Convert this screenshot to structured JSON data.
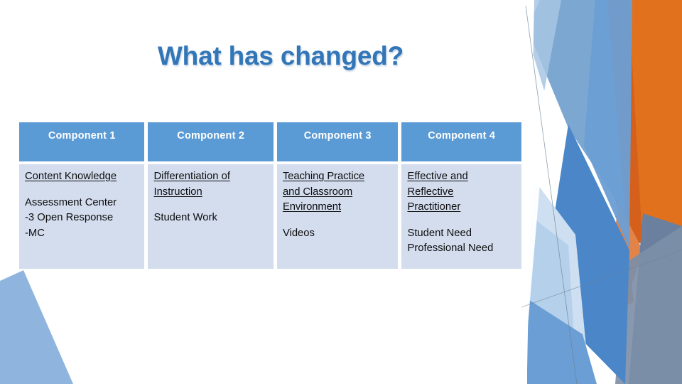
{
  "slide": {
    "title": "What has changed?",
    "title_color": "#3276b8",
    "background": "#ffffff"
  },
  "table": {
    "header_bg": "#5b9bd5",
    "header_text_color": "#ffffff",
    "cell_bg": "#d3ddee",
    "cell_text_color": "#0d0d0d",
    "headers": [
      "Component 1",
      "Component 2",
      "Component  3",
      "Component  4"
    ],
    "columns": [
      {
        "heading": "Content Knowledge",
        "lines": [
          "Assessment Center",
          "-3 Open Response",
          "-MC"
        ]
      },
      {
        "heading_line1": "Differentiation of",
        "heading_line2": "Instruction",
        "lines": [
          "Student Work"
        ]
      },
      {
        "heading_line1": "Teaching Practice",
        "heading_line2": "and Classroom",
        "heading_line3": "Environment",
        "lines": [
          "Videos"
        ]
      },
      {
        "heading_line1": "Effective and",
        "heading_line2": "Reflective",
        "heading_line3": "Practitioner",
        "lines": [
          "Student Need",
          "Professional Need"
        ]
      }
    ]
  },
  "decoration": {
    "name": "facet-theme-polygons",
    "colors": {
      "orange_dark": "#d4601c",
      "orange_mid": "#e2711d",
      "orange_light": "#e0844a",
      "blue_steel": "#7ba7d0",
      "blue_mid": "#6b9ed4",
      "blue_deep": "#4a86c8",
      "blue_pale": "#c3d8ee",
      "blue_paler": "#dfeaf6",
      "blue_gray": "#6b7f9e",
      "blue_gray_light": "#7d8fa8",
      "blue_left": "#8fb4dd"
    }
  }
}
